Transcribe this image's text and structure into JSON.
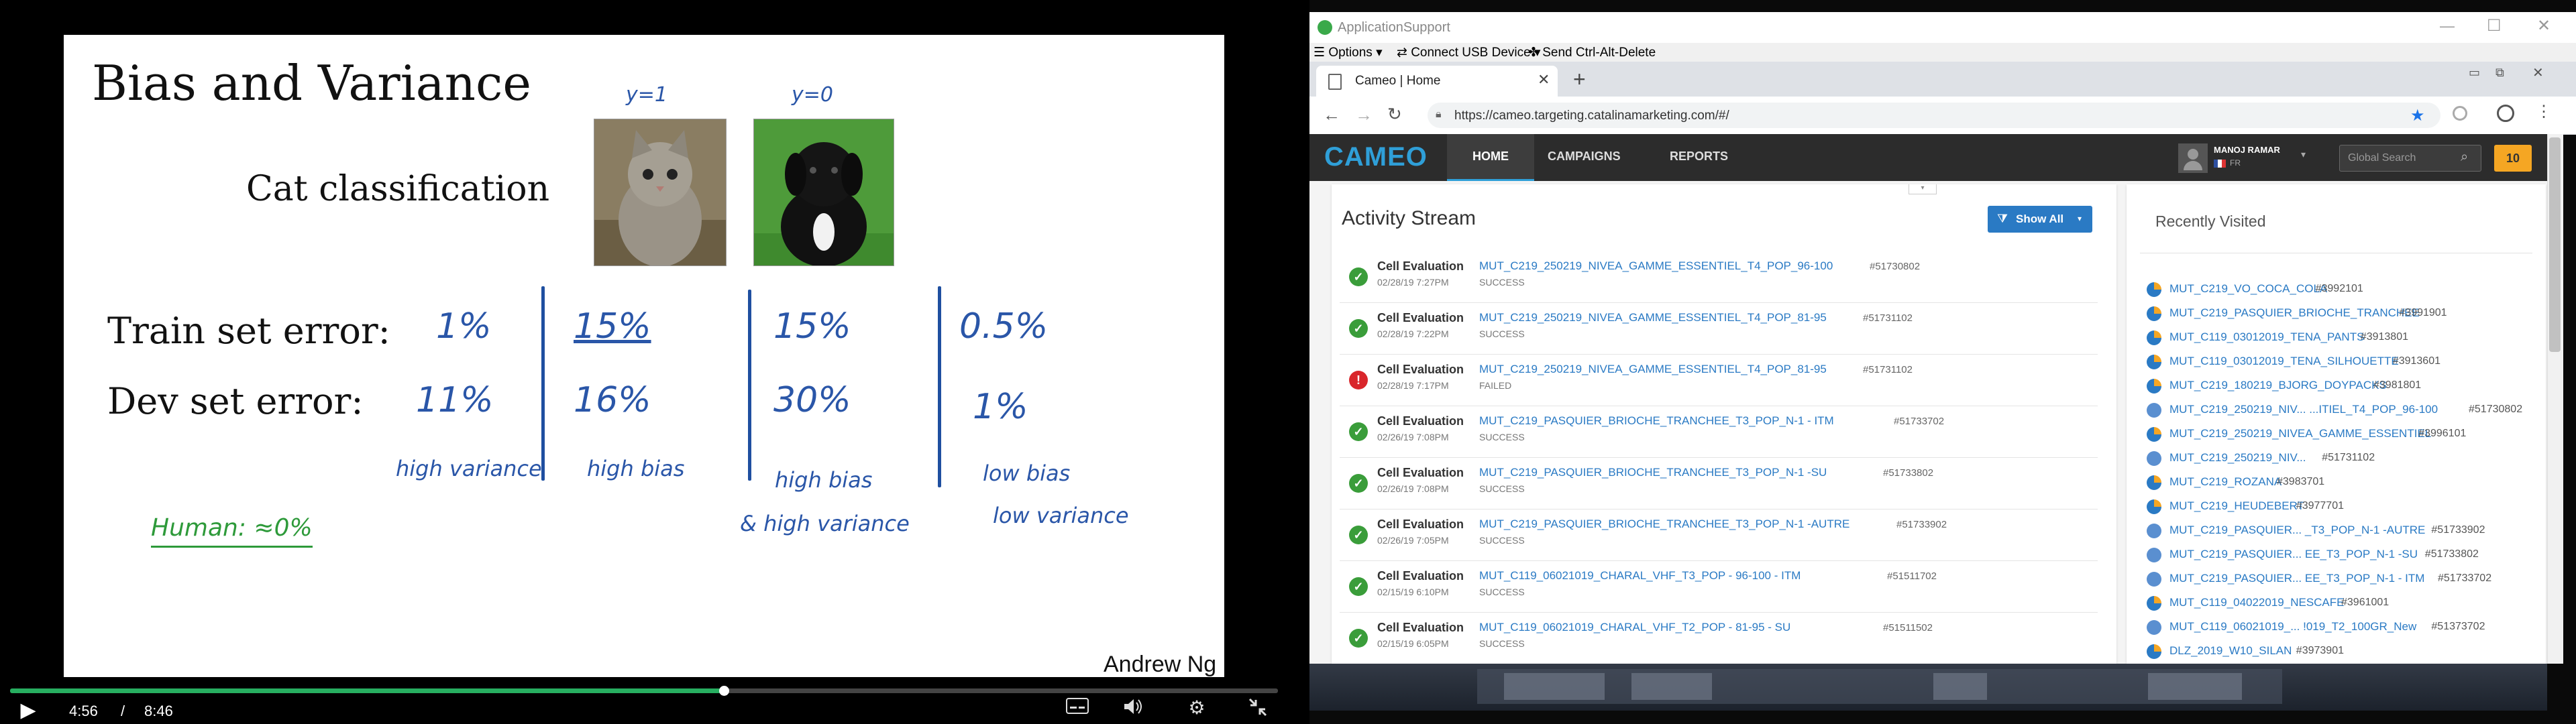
{
  "video": {
    "slide": {
      "title": "Bias and Variance",
      "subtitle": "Cat classification",
      "label_y1": "y=1",
      "label_y0": "y=0",
      "row_train": "Train set error:",
      "row_dev": "Dev set error:",
      "train_values": [
        "1%",
        "15%",
        "15%",
        "0.5%"
      ],
      "dev_values": [
        "11%",
        "16%",
        "30%",
        "1%"
      ],
      "diagnosis": [
        "high variance",
        "high bias",
        "high bias",
        "low bias"
      ],
      "diagnosis_line2": [
        "",
        "",
        "& high variance",
        "low variance"
      ],
      "human_note": "Human: ≈0%",
      "author": "Andrew Ng"
    },
    "controls": {
      "current_time": "4:56",
      "separator": "/",
      "duration": "8:46",
      "progress": 0.5627
    }
  },
  "remote": {
    "app_title": "ApplicationSupport",
    "menu": {
      "options": "Options",
      "usb": "Connect USB Device",
      "cad": "Send Ctrl-Alt-Delete"
    },
    "browser": {
      "tab_title": "Cameo | Home",
      "url": "https://cameo.targeting.catalinamarketing.com/#/"
    },
    "cameo": {
      "logo": "CAMEO",
      "nav": [
        "HOME",
        "CAMPAIGNS",
        "REPORTS"
      ],
      "user_name": "MANOJ RAMAR",
      "user_locale": "FR",
      "search_placeholder": "Global Search",
      "notification_count": "10",
      "activity_title": "Activity Stream",
      "show_all": "Show All",
      "recent_title": "Recently Visited",
      "activities": [
        {
          "type": "Cell Evaluation",
          "name": "MUT_C219_250219_NIVEA_GAMME_ESSENTIEL_T4_POP_96-100",
          "id": "#51730802",
          "date": "02/28/19 7:27PM",
          "status": "SUCCESS",
          "ok": true
        },
        {
          "type": "Cell Evaluation",
          "name": "MUT_C219_250219_NIVEA_GAMME_ESSENTIEL_T4_POP_81-95",
          "id": "#51731102",
          "date": "02/28/19 7:22PM",
          "status": "SUCCESS",
          "ok": true
        },
        {
          "type": "Cell Evaluation",
          "name": "MUT_C219_250219_NIVEA_GAMME_ESSENTIEL_T4_POP_81-95",
          "id": "#51731102",
          "date": "02/28/19 7:17PM",
          "status": "FAILED",
          "ok": false
        },
        {
          "type": "Cell Evaluation",
          "name": "MUT_C219_PASQUIER_BRIOCHE_TRANCHEE_T3_POP_N-1 - ITM",
          "id": "#51733702",
          "date": "02/26/19 7:08PM",
          "status": "SUCCESS",
          "ok": true
        },
        {
          "type": "Cell Evaluation",
          "name": "MUT_C219_PASQUIER_BRIOCHE_TRANCHEE_T3_POP_N-1 -SU",
          "id": "#51733802",
          "date": "02/26/19 7:08PM",
          "status": "SUCCESS",
          "ok": true
        },
        {
          "type": "Cell Evaluation",
          "name": "MUT_C219_PASQUIER_BRIOCHE_TRANCHEE_T3_POP_N-1 -AUTRE",
          "id": "#51733902",
          "date": "02/26/19 7:05PM",
          "status": "SUCCESS",
          "ok": true
        },
        {
          "type": "Cell Evaluation",
          "name": "MUT_C119_06021019_CHARAL_VHF_T3_POP - 96-100 - ITM",
          "id": "#51511702",
          "date": "02/15/19 6:10PM",
          "status": "SUCCESS",
          "ok": true
        },
        {
          "type": "Cell Evaluation",
          "name": "MUT_C119_06021019_CHARAL_VHF_T2_POP - 81-95 - SU",
          "id": "#51511502",
          "date": "02/15/19 6:05PM",
          "status": "SUCCESS",
          "ok": true
        }
      ],
      "recent": [
        {
          "name": "MUT_C219_VO_COCA_COLA",
          "id": "#3992101",
          "icon": "pie"
        },
        {
          "name": "MUT_C219_PASQUIER_BRIOCHE_TRANCHEE",
          "id": "#3991901",
          "icon": "pie"
        },
        {
          "name": "MUT_C119_03012019_TENA_PANTS",
          "id": "#3913801",
          "icon": "pie"
        },
        {
          "name": "MUT_C119_03012019_TENA_SILHOUETTE",
          "id": "#3913601",
          "icon": "pie"
        },
        {
          "name": "MUT_C219_180219_BJORG_DOYPACKS",
          "id": "#3981801",
          "icon": "pie"
        },
        {
          "name": "MUT_C219_250219_NIV... ...ITIEL_T4_POP_96-100",
          "id": "#51730802",
          "icon": "blocked"
        },
        {
          "name": "MUT_C219_250219_NIVEA_GAMME_ESSENTIEL",
          "id": "#3996101",
          "icon": "pie"
        },
        {
          "name": "MUT_C219_250219_NIV...",
          "id": "#51731102",
          "icon": "blocked"
        },
        {
          "name": "MUT_C219_ROZANA",
          "id": "#3983701",
          "icon": "pie"
        },
        {
          "name": "MUT_C219_HEUDEBERT",
          "id": "#3977701",
          "icon": "pie"
        },
        {
          "name": "MUT_C219_PASQUIER... _T3_POP_N-1 -AUTRE",
          "id": "#51733902",
          "icon": "blocked"
        },
        {
          "name": "MUT_C219_PASQUIER... EE_T3_POP_N-1 -SU",
          "id": "#51733802",
          "icon": "blocked"
        },
        {
          "name": "MUT_C219_PASQUIER... EE_T3_POP_N-1 - ITM",
          "id": "#51733702",
          "icon": "blocked"
        },
        {
          "name": "MUT_C119_04022019_NESCAFE",
          "id": "#3961001",
          "icon": "pie"
        },
        {
          "name": "MUT_C119_06021019_... !019_T2_100GR_New",
          "id": "#51373702",
          "icon": "blocked"
        },
        {
          "name": "DLZ_2019_W10_SILAN",
          "id": "#3973901",
          "icon": "pie"
        }
      ]
    }
  }
}
